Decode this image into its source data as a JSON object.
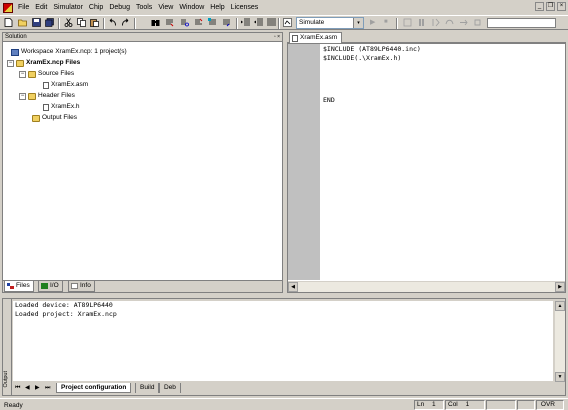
{
  "menu": {
    "items": [
      "File",
      "Edit",
      "Simulator",
      "Chip",
      "Debug",
      "Tools",
      "View",
      "Window",
      "Help",
      "Licenses"
    ],
    "mdi_min": "_",
    "mdi_restore": "❐",
    "mdi_close": "×"
  },
  "toolbar": {
    "mode_value": "Simulate",
    "mode_arrow": "▾",
    "run_icon": "▶",
    "stop_icon": "■"
  },
  "solution": {
    "title": "Solution",
    "buttons": "▫ ×",
    "tree": {
      "workspace": "Workspace XramEx.ncp: 1 project(s)",
      "project": "XramEx.ncp Files",
      "source_folder": "Source Files",
      "source_file": "XramEx.asm",
      "header_folder": "Header Files",
      "header_file": "XramEx.h",
      "output_folder": "Output Files"
    },
    "tabs": [
      "Files",
      "I/O",
      "Info"
    ]
  },
  "editor": {
    "tab_label": "XramEx.asm",
    "code_lines": [
      "$INCLUDE (AT89LP6440.inc)",
      "$INCLUDE(.\\XramEx.h)",
      "",
      "",
      "",
      "",
      "END"
    ]
  },
  "output": {
    "side_label": "Output",
    "lines": [
      "Loaded device: AT89LP6440",
      "Loaded project: XramEx.ncp"
    ],
    "nav": [
      "⏮",
      "◀",
      "▶",
      "⏭"
    ],
    "tabs": [
      "Project configuration",
      "Build",
      "Deb"
    ]
  },
  "status": {
    "message": "Ready",
    "ln_label": "Ln",
    "ln_value": "1",
    "col_label": "Col",
    "col_value": "1",
    "ovr": "OVR"
  },
  "colors": {
    "chrome": "#d4d0c8",
    "gutter": "#c0c0c0",
    "editor_bg": "#ffffff"
  }
}
